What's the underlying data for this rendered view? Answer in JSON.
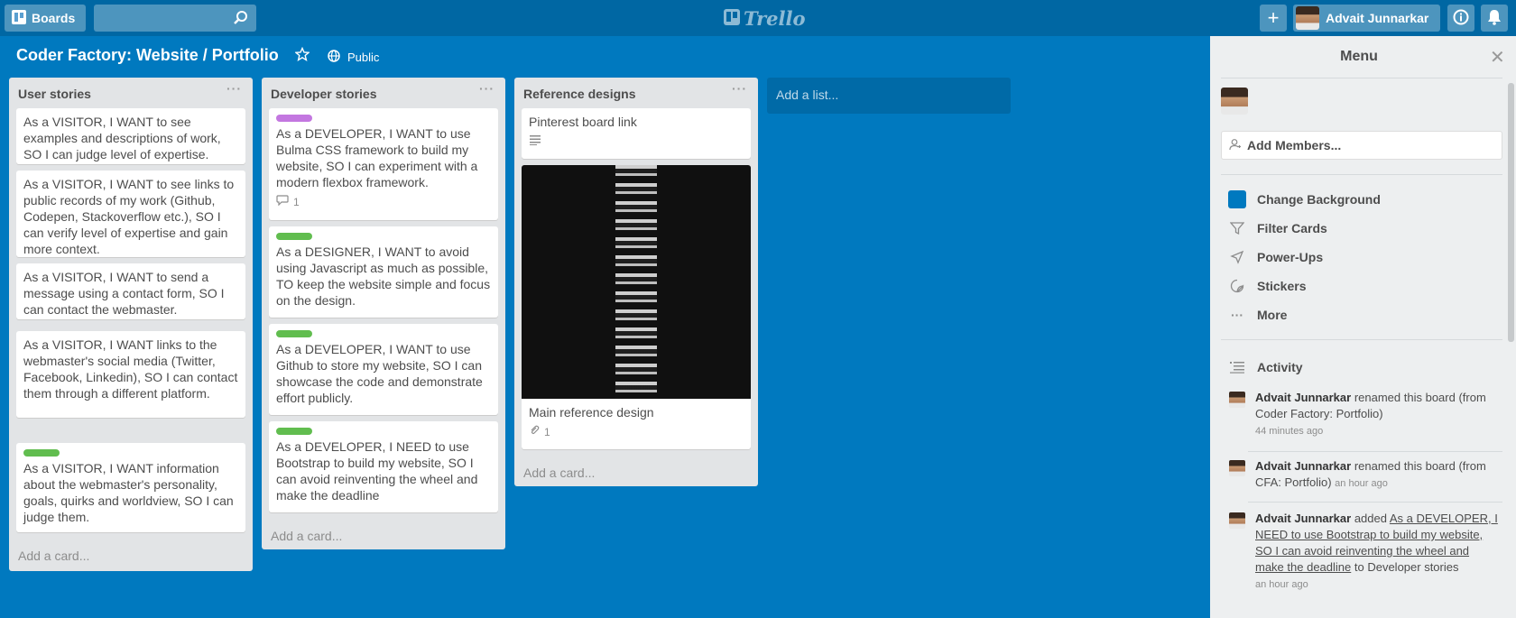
{
  "header": {
    "boards_label": "Boards",
    "search_placeholder": "",
    "logo_text": "Trello",
    "user_name": "Advait Junnarkar"
  },
  "board": {
    "title": "Coder Factory: Website / Portfolio",
    "visibility": "Public"
  },
  "lists": [
    {
      "title": "User stories",
      "cards": [
        {
          "text": "As a VISITOR, I WANT to see examples and descriptions of work, SO I can judge level of expertise."
        },
        {
          "text": "As a VISITOR, I WANT to see links to public records of my work (Github, Codepen, Stackoverflow etc.), SO I can verify level of expertise and gain more context."
        },
        {
          "text": "As a VISITOR, I WANT to send a message using a contact form, SO I can contact the webmaster."
        },
        {
          "text": "As a VISITOR, I WANT links to the webmaster's social media (Twitter, Facebook, Linkedin), SO I can contact them through a different platform."
        },
        {
          "text": "As a VISITOR, I WANT information about the webmaster's personality, goals, quirks and worldview, SO I can judge them.",
          "label": "#61bd4f"
        }
      ],
      "add_card": "Add a card..."
    },
    {
      "title": "Developer stories",
      "cards": [
        {
          "text": "As a DEVELOPER, I WANT to use Bulma CSS framework to build my website, SO I can experiment with a modern flexbox framework.",
          "label": "#c377e0",
          "comments": "1"
        },
        {
          "text": "As a DESIGNER, I WANT to avoid using Javascript as much as possible, TO keep the website simple and focus on the design.",
          "label": "#61bd4f"
        },
        {
          "text": "As a DEVELOPER, I WANT to use Github to store my website, SO I can showcase the code and demonstrate effort publicly.",
          "label": "#61bd4f"
        },
        {
          "text": "As a DEVELOPER, I NEED to use Bootstrap to build my website, SO I can avoid reinventing the wheel and make the deadline",
          "label": "#61bd4f"
        }
      ],
      "add_card": "Add a card..."
    },
    {
      "title": "Reference designs",
      "cards": [
        {
          "text": "Pinterest board link"
        },
        {
          "text": "Main reference design",
          "attachments": "1"
        }
      ],
      "add_card": "Add a card..."
    }
  ],
  "add_list": "Add a list...",
  "menu": {
    "title": "Menu",
    "add_members": "Add Members...",
    "items": [
      "Change Background",
      "Filter Cards",
      "Power-Ups",
      "Stickers",
      "More"
    ],
    "activity_title": "Activity",
    "activity": [
      {
        "user": "Advait Junnarkar",
        "action": "renamed this board (from Coder Factory: Portfolio)",
        "time": "44 minutes ago"
      },
      {
        "user": "Advait Junnarkar",
        "action": "renamed this board (from CFA: Portfolio)",
        "time": "an hour ago"
      },
      {
        "user": "Advait Junnarkar",
        "action": "added",
        "link": "As a DEVELOPER, I NEED to use Bootstrap to build my website, SO I can avoid reinventing the wheel and make the deadline",
        "suffix": "to Developer stories",
        "time": "an hour ago"
      }
    ]
  },
  "colors": {
    "board_bg": "#0079bf",
    "header_bg": "#0067a3",
    "label_green": "#61bd4f",
    "label_purple": "#c377e0"
  }
}
